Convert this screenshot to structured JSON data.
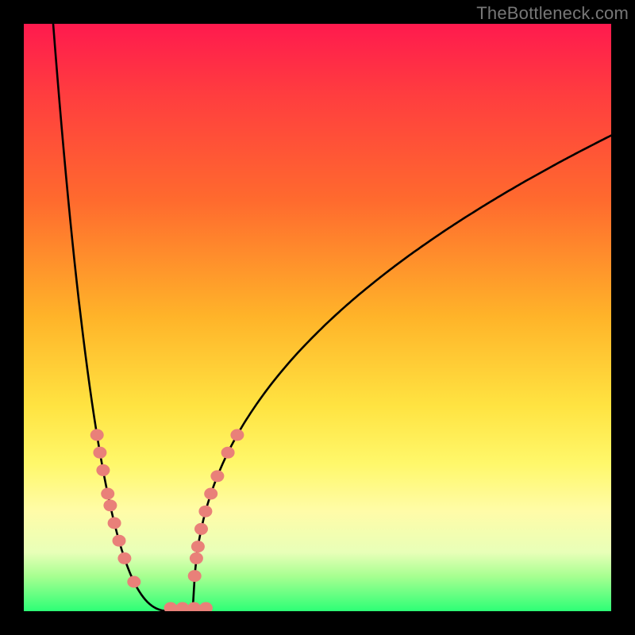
{
  "watermark": "TheBottleneck.com",
  "colors": {
    "dot_fill": "#e98079",
    "curve_stroke": "#000000",
    "gradient_top": "#ff1a4e",
    "gradient_bottom": "#2dff76"
  },
  "chart_data": {
    "type": "line",
    "title": "",
    "xlabel": "",
    "ylabel": "",
    "xlim": [
      0,
      100
    ],
    "ylim": [
      0,
      100
    ],
    "curve": {
      "left_top": {
        "x": 5,
        "y": 100
      },
      "apex": {
        "x": 27,
        "y": 0
      },
      "right_end": {
        "x": 100,
        "y": 81
      },
      "description": "Asymmetric V-curve; steep descent on left, concave-down rise on right"
    },
    "left_dots_y": [
      30,
      27,
      24,
      20,
      18,
      15,
      12,
      9,
      5
    ],
    "right_dots_y": [
      30,
      27,
      23,
      20,
      17,
      14,
      11,
      9,
      6
    ],
    "bottom_dots_x": [
      25,
      27,
      29,
      31
    ],
    "note": "x and y expressed as 0–100 fraction of plot area; y=0 is bottom (green), y=100 is top (red). Values are visual estimates."
  }
}
